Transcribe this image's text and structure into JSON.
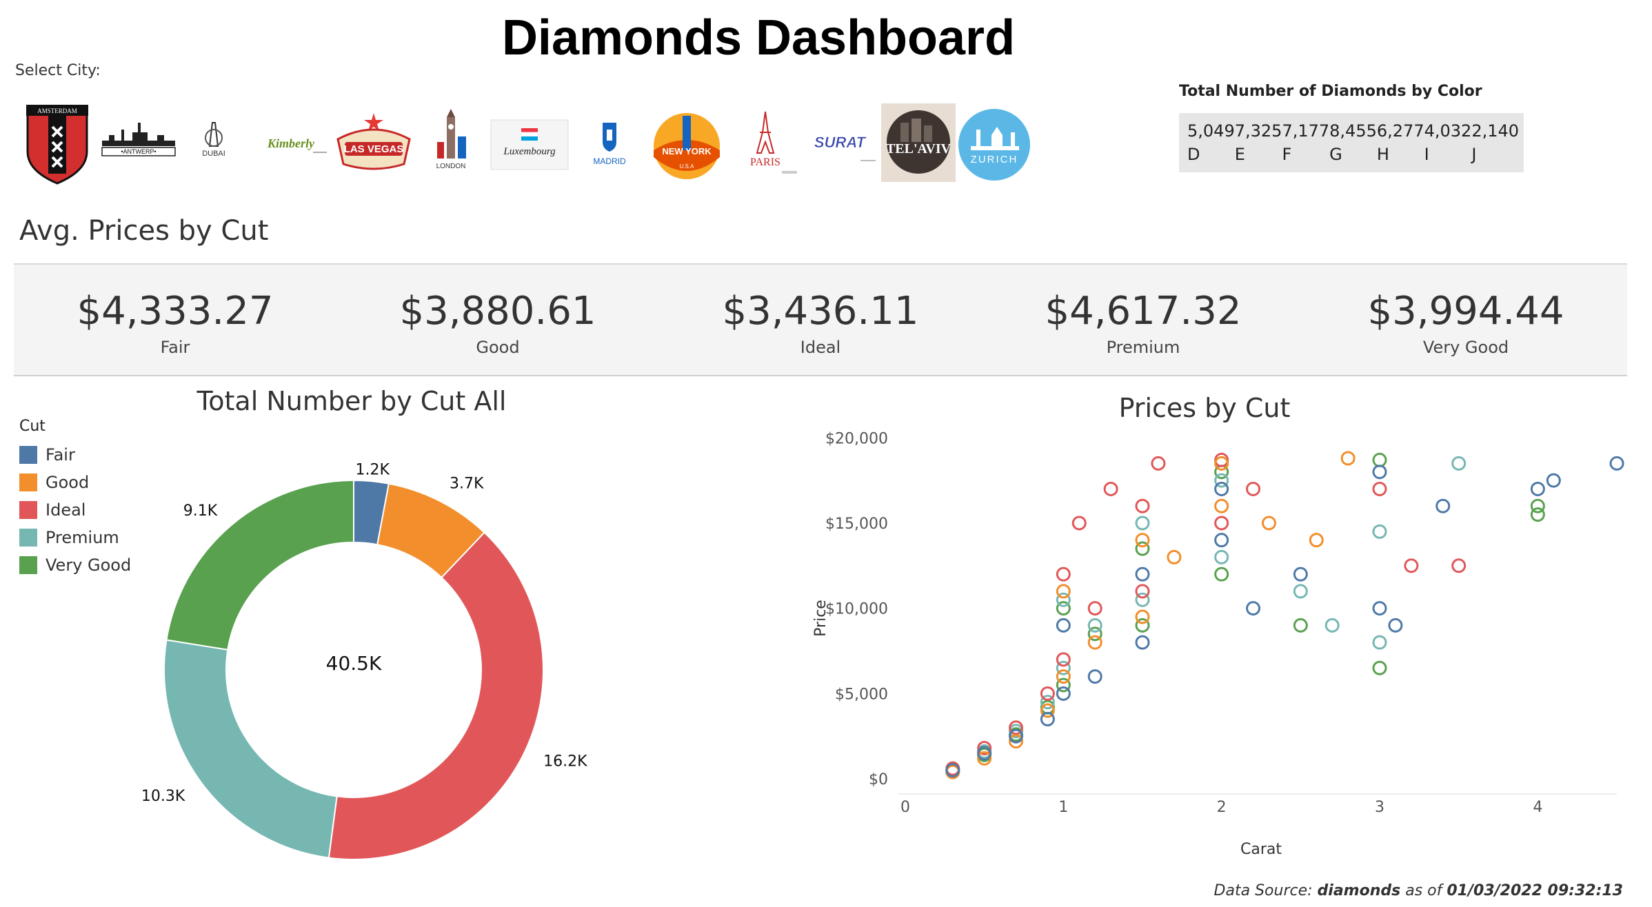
{
  "title": "Diamonds Dashboard",
  "select_city_label": "Select City:",
  "cities": [
    {
      "name": "AMSTERDAM",
      "icon": "amsterdam-icon"
    },
    {
      "name": "ANTWERP",
      "icon": "antwerp-icon"
    },
    {
      "name": "DUBAI",
      "icon": "dubai-icon"
    },
    {
      "name": "Kimberly",
      "icon": "kimberly-icon"
    },
    {
      "name": "LAS VEGAS",
      "icon": "las-vegas-icon"
    },
    {
      "name": "LONDON",
      "icon": "london-icon"
    },
    {
      "name": "Luxembourg",
      "icon": "luxembourg-icon"
    },
    {
      "name": "MADRID",
      "icon": "madrid-icon"
    },
    {
      "name": "NEW YORK",
      "icon": "new-york-icon"
    },
    {
      "name": "PARIS",
      "icon": "paris-icon"
    },
    {
      "name": "SURAT",
      "icon": "surat-icon"
    },
    {
      "name": "TEL'AVIV",
      "icon": "tel-aviv-icon"
    },
    {
      "name": "ZURICH",
      "icon": "zurich-icon"
    }
  ],
  "color_summary": {
    "title": "Total Number of Diamonds by Color",
    "items": [
      {
        "count": "5,049",
        "color": "D"
      },
      {
        "count": "7,325",
        "color": "E"
      },
      {
        "count": "7,177",
        "color": "F"
      },
      {
        "count": "8,455",
        "color": "G"
      },
      {
        "count": "6,277",
        "color": "H"
      },
      {
        "count": "4,032",
        "color": "I"
      },
      {
        "count": "2,140",
        "color": "J"
      }
    ]
  },
  "avg_prices": {
    "title": "Avg. Prices by Cut",
    "items": [
      {
        "value": "$4,333.27",
        "cut": "Fair"
      },
      {
        "value": "$3,880.61",
        "cut": "Good"
      },
      {
        "value": "$3,436.11",
        "cut": "Ideal"
      },
      {
        "value": "$4,617.32",
        "cut": "Premium"
      },
      {
        "value": "$3,994.44",
        "cut": "Very Good"
      }
    ]
  },
  "legend": {
    "title": "Cut",
    "items": [
      {
        "label": "Fair",
        "color": "#4e79a7"
      },
      {
        "label": "Good",
        "color": "#f28e2b"
      },
      {
        "label": "Ideal",
        "color": "#e15759"
      },
      {
        "label": "Premium",
        "color": "#76b7b2"
      },
      {
        "label": "Very Good",
        "color": "#59a14f"
      }
    ]
  },
  "footer": {
    "prefix": "Data Source: ",
    "source": "diamonds",
    "middle": " as of ",
    "timestamp": "01/03/2022 09:32:13"
  },
  "chart_data": [
    {
      "type": "pie",
      "title": "Total Number by Cut All",
      "center_label": "40.5K",
      "categories": [
        "Fair",
        "Good",
        "Ideal",
        "Premium",
        "Very Good"
      ],
      "values": [
        1200,
        3700,
        16200,
        10300,
        9100
      ],
      "labels": [
        "1.2K",
        "3.7K",
        "16.2K",
        "10.3K",
        "9.1K"
      ],
      "colors": [
        "#4e79a7",
        "#f28e2b",
        "#e15759",
        "#76b7b2",
        "#59a14f"
      ]
    },
    {
      "type": "scatter",
      "title": "Prices by Cut",
      "xlabel": "Carat",
      "ylabel": "Price",
      "xlim": [
        0,
        4.5
      ],
      "ylim": [
        0,
        19000
      ],
      "xticks": [
        "0",
        "1",
        "2",
        "3",
        "4"
      ],
      "yticks": [
        "$0",
        "$5,000",
        "$10,000",
        "$15,000",
        "$20,000"
      ],
      "series": [
        {
          "name": "Fair",
          "color": "#4e79a7",
          "points": [
            [
              0.3,
              500
            ],
            [
              0.5,
              1500
            ],
            [
              0.7,
              2500
            ],
            [
              0.9,
              3500
            ],
            [
              1.0,
              5000
            ],
            [
              1.0,
              9000
            ],
            [
              1.2,
              6000
            ],
            [
              1.5,
              8000
            ],
            [
              1.5,
              12000
            ],
            [
              2.0,
              14000
            ],
            [
              2.0,
              17000
            ],
            [
              2.2,
              10000
            ],
            [
              2.5,
              12000
            ],
            [
              3.0,
              18000
            ],
            [
              3.0,
              10000
            ],
            [
              3.1,
              9000
            ],
            [
              3.4,
              16000
            ],
            [
              4.0,
              17000
            ],
            [
              4.1,
              17500
            ],
            [
              4.5,
              18500
            ]
          ]
        },
        {
          "name": "Good",
          "color": "#f28e2b",
          "points": [
            [
              0.3,
              400
            ],
            [
              0.5,
              1200
            ],
            [
              0.7,
              2200
            ],
            [
              0.9,
              4000
            ],
            [
              1.0,
              6000
            ],
            [
              1.0,
              11000
            ],
            [
              1.2,
              8000
            ],
            [
              1.5,
              9500
            ],
            [
              1.5,
              14000
            ],
            [
              1.7,
              13000
            ],
            [
              2.0,
              16000
            ],
            [
              2.0,
              18500
            ],
            [
              2.3,
              15000
            ],
            [
              2.6,
              14000
            ],
            [
              2.8,
              18800
            ]
          ]
        },
        {
          "name": "Ideal",
          "color": "#e15759",
          "points": [
            [
              0.3,
              600
            ],
            [
              0.5,
              1800
            ],
            [
              0.7,
              3000
            ],
            [
              0.9,
              5000
            ],
            [
              1.0,
              7000
            ],
            [
              1.0,
              12000
            ],
            [
              1.1,
              15000
            ],
            [
              1.2,
              10000
            ],
            [
              1.3,
              17000
            ],
            [
              1.5,
              11000
            ],
            [
              1.5,
              16000
            ],
            [
              1.6,
              18500
            ],
            [
              2.0,
              15000
            ],
            [
              2.0,
              18700
            ],
            [
              2.2,
              17000
            ],
            [
              3.0,
              17000
            ],
            [
              3.2,
              12500
            ],
            [
              3.5,
              12500
            ]
          ]
        },
        {
          "name": "Premium",
          "color": "#76b7b2",
          "points": [
            [
              0.3,
              500
            ],
            [
              0.5,
              1600
            ],
            [
              0.7,
              2800
            ],
            [
              0.9,
              4500
            ],
            [
              1.0,
              6500
            ],
            [
              1.0,
              10500
            ],
            [
              1.2,
              9000
            ],
            [
              1.5,
              10500
            ],
            [
              1.5,
              15000
            ],
            [
              2.0,
              13000
            ],
            [
              2.0,
              17500
            ],
            [
              2.5,
              11000
            ],
            [
              2.7,
              9000
            ],
            [
              3.0,
              8000
            ],
            [
              3.0,
              14500
            ],
            [
              3.5,
              18500
            ]
          ]
        },
        {
          "name": "Very Good",
          "color": "#59a14f",
          "points": [
            [
              0.3,
              450
            ],
            [
              0.5,
              1400
            ],
            [
              0.7,
              2600
            ],
            [
              0.9,
              4200
            ],
            [
              1.0,
              5500
            ],
            [
              1.0,
              10000
            ],
            [
              1.2,
              8500
            ],
            [
              1.5,
              9000
            ],
            [
              1.5,
              13500
            ],
            [
              2.0,
              12000
            ],
            [
              2.0,
              18000
            ],
            [
              2.5,
              9000
            ],
            [
              3.0,
              6500
            ],
            [
              3.0,
              18700
            ],
            [
              4.0,
              15500
            ],
            [
              4.0,
              16000
            ]
          ]
        }
      ]
    }
  ]
}
